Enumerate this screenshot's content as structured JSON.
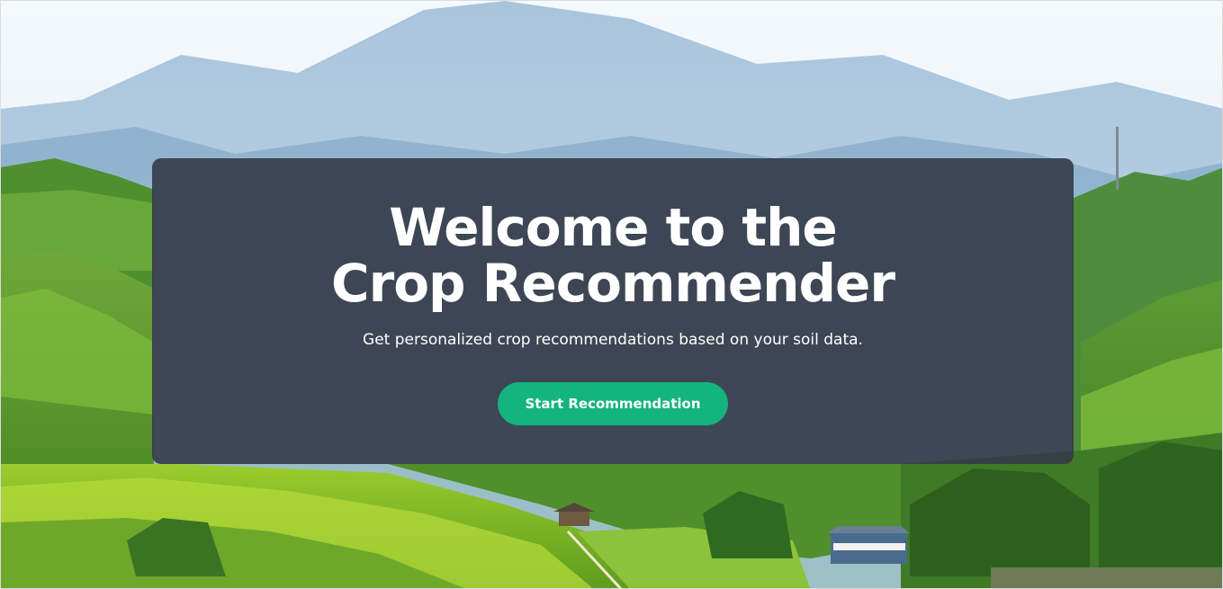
{
  "hero": {
    "title": "Welcome to the Crop Recommender",
    "subtitle": "Get personalized crop recommendations based on your soil data.",
    "cta_label": "Start Recommendation"
  },
  "colors": {
    "card_background": "#343a48",
    "cta_background": "#13b47e",
    "text": "#ffffff"
  }
}
